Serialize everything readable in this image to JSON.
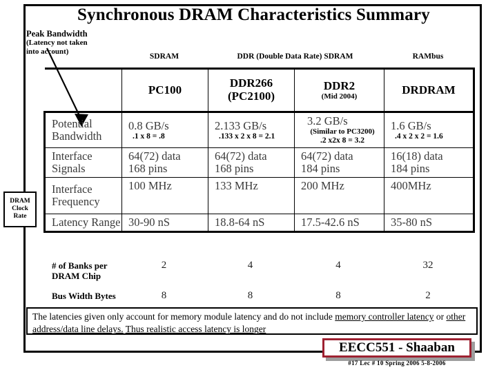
{
  "slide": {
    "title": "Synchronous DRAM  Characteristics Summary"
  },
  "annotation": {
    "line1": "Peak Bandwidth",
    "line2": "(Latency not taken",
    "line3": "into account)",
    "arrow_icon": "down-right-arrow-icon"
  },
  "group_headers": {
    "sdram": "SDRAM",
    "ddr": "DDR (Double Data Rate) SDRAM",
    "rambus": "RAMbus"
  },
  "side_callout": {
    "line1": "DRAM",
    "line2": "Clock",
    "line3": "Rate"
  },
  "table": {
    "columns": [
      {
        "name": "PC100",
        "sub": ""
      },
      {
        "name": "DDR266",
        "sub": "(PC2100)"
      },
      {
        "name": "DDR2",
        "sub": "(Mid 2004)"
      },
      {
        "name": "DRDRAM",
        "sub": ""
      }
    ],
    "rows": [
      {
        "label_l1": "Potential",
        "label_l2": "Bandwidth",
        "cells": [
          {
            "main": "0.8 GB/s",
            "calc": ".1 x 8 = .8",
            "note": ""
          },
          {
            "main": "2.133 GB/s",
            "calc": ".133 x 2 x 8 = 2.1",
            "note": ""
          },
          {
            "main": "3.2 GB/s",
            "calc": ".2 x2x  8 = 3.2",
            "note": "(Similar to PC3200)"
          },
          {
            "main": "1.6 GB/s",
            "calc": ".4 x 2 x 2 = 1.6",
            "note": ""
          }
        ]
      },
      {
        "label_l1": "Interface",
        "label_l2": "Signals",
        "cells": [
          {
            "main": "64(72) data",
            "calc2": "168 pins"
          },
          {
            "main": "64(72) data",
            "calc2": "168 pins"
          },
          {
            "main": "64(72) data",
            "calc2": "184 pins"
          },
          {
            "main": "16(18) data",
            "calc2": "184 pins"
          }
        ]
      },
      {
        "label_l1": "Interface",
        "label_l2": "Frequency",
        "cells": [
          {
            "main": "100 MHz"
          },
          {
            "main": "133 MHz"
          },
          {
            "main": "200 MHz"
          },
          {
            "main": "400MHz"
          }
        ]
      },
      {
        "label_l1": "Latency Range",
        "label_l2": "",
        "cells": [
          {
            "main": "30-90 nS"
          },
          {
            "main": "18.8-64 nS"
          },
          {
            "main": "17.5-42.6 nS"
          },
          {
            "main": "35-80 nS"
          }
        ]
      }
    ]
  },
  "bottom_table": {
    "rows": [
      {
        "label_l1": "# of Banks per",
        "label_l2": "DRAM  Chip",
        "values": [
          "2",
          "4",
          "4",
          "32"
        ]
      },
      {
        "label_l1": "Bus Width Bytes",
        "label_l2": "",
        "values": [
          "8",
          "8",
          "8",
          "2"
        ]
      }
    ]
  },
  "note": {
    "p1": "The latencies given only account for memory module latency and do not include ",
    "u1": "memory controller latency",
    "p2": " or ",
    "u2": "other address/data line delays.",
    "p3": "  ",
    "u3": "Thus realistic access latency is longer"
  },
  "footer": {
    "badge": "EECC551 - Shaaban",
    "meta": "#17   Lec # 10   Spring 2006  5-8-2006",
    "badge_border_color": "#9e2131"
  }
}
